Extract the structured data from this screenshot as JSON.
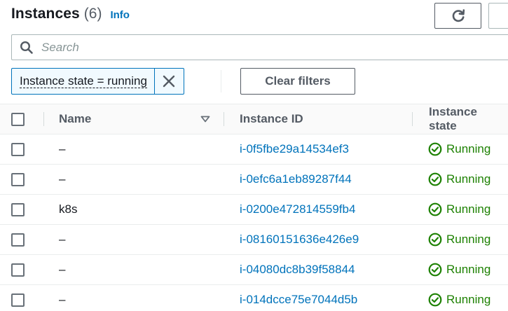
{
  "header": {
    "title": "Instances",
    "count": "(6)",
    "info_label": "Info"
  },
  "search": {
    "placeholder": "Search"
  },
  "filter": {
    "token_label": "Instance state = running",
    "clear_label": "Clear filters"
  },
  "table": {
    "columns": [
      "Name",
      "Instance ID",
      "Instance state"
    ],
    "rows": [
      {
        "name": "–",
        "id": "i-0f5fbe29a14534ef3",
        "state": "Running"
      },
      {
        "name": "–",
        "id": "i-0efc6a1eb89287f44",
        "state": "Running"
      },
      {
        "name": "k8s",
        "id": "i-0200e472814559fb4",
        "state": "Running"
      },
      {
        "name": "–",
        "id": "i-08160151636e426e9",
        "state": "Running"
      },
      {
        "name": "–",
        "id": "i-04080dc8b39f58844",
        "state": "Running"
      },
      {
        "name": "–",
        "id": "i-014dcce75e7044d5b",
        "state": "Running"
      }
    ]
  },
  "colors": {
    "link": "#0073bb",
    "running": "#1d8102",
    "text": "#16191f",
    "muted": "#545b64"
  },
  "icons": {
    "refresh": "refresh-icon",
    "search": "search-icon",
    "dismiss": "close-icon",
    "sort": "sort-down-icon",
    "state": "check-circle-icon"
  }
}
